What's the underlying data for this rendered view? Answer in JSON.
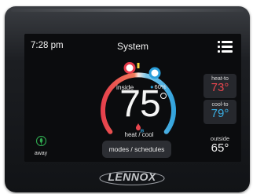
{
  "device": {
    "brand": "LENNOX",
    "screen": {
      "time": "7:28 pm",
      "title": "System",
      "menu_icon": "menu-list-icon",
      "inside_label": "inside",
      "humidity": "60%",
      "inside_temp": "75",
      "mode": "heat / cool",
      "modes_button": "modes / schedules",
      "heat_to": {
        "label": "heat-to",
        "value": "73°"
      },
      "cool_to": {
        "label": "cool-to",
        "value": "79°"
      },
      "outside": {
        "label": "outside",
        "value": "65°"
      },
      "away": {
        "label": "away",
        "icon": "away-leaf-icon"
      }
    },
    "colors": {
      "heat": "#e8464e",
      "cool": "#3aaee3",
      "away_icon": "#2fa84f"
    }
  }
}
